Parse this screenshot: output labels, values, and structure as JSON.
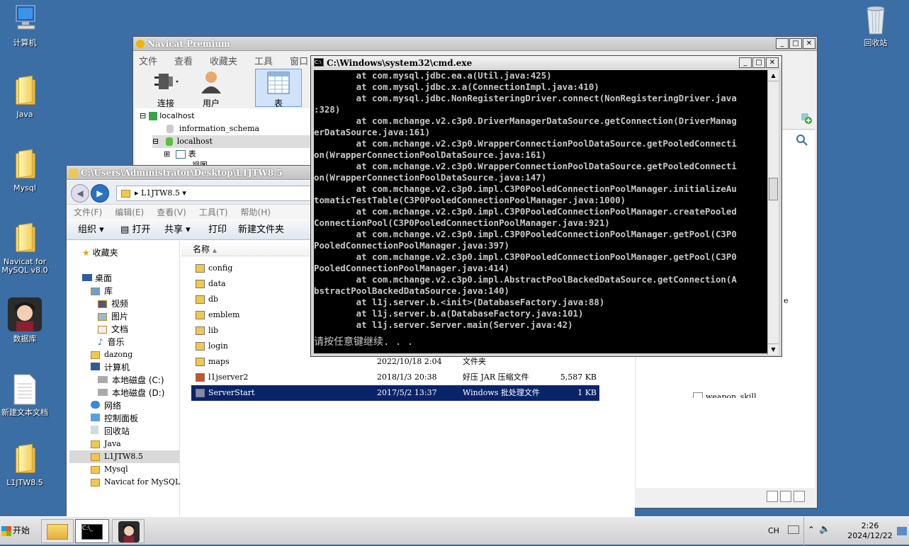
{
  "desktop": {
    "icons": [
      {
        "label": "计算机",
        "icon": "computer-icon"
      },
      {
        "label": "Java",
        "icon": "folder-icon"
      },
      {
        "label": "Mysql",
        "icon": "folder-icon"
      },
      {
        "label": "Navicat for MySQL v8.0",
        "icon": "folder-icon"
      },
      {
        "label": "数据库",
        "icon": "avatar-icon"
      },
      {
        "label": "新建文本文档",
        "icon": "text-file-icon"
      },
      {
        "label": "L1JTW8.5",
        "icon": "folder-icon"
      },
      {
        "label": "回收站",
        "icon": "recycle-bin-icon"
      }
    ]
  },
  "navicat": {
    "title": "Navicat Premium",
    "menu": [
      "文件",
      "查看",
      "收藏夹",
      "工具",
      "窗口"
    ],
    "toolbar": {
      "connect": "连接",
      "user": "用户",
      "table": "表"
    },
    "tree": {
      "root": "localhost",
      "db1": "information_schema",
      "db2": "localhost",
      "table_node": "表",
      "clipped": "视图"
    },
    "right_item": "weapon_skill",
    "right_clipped": "e"
  },
  "explorer": {
    "title": "C:\\Users\\Administrator\\Desktop\\L1JTW8.5",
    "address": "L1JTW8.5",
    "menu": [
      "文件(F)",
      "编辑(E)",
      "查看(V)",
      "工具(T)",
      "帮助(H)"
    ],
    "toolbar": [
      "组织",
      "打开",
      "共享",
      "打印",
      "新建文件夹"
    ],
    "column_name": "名称",
    "sidebar": {
      "favorites": "收藏夹",
      "desktop": "桌面",
      "library": "库",
      "video": "视频",
      "pictures": "图片",
      "docs": "文档",
      "music": "音乐",
      "dazong": "dazong",
      "computer": "计算机",
      "disk_c": "本地磁盘 (C:)",
      "disk_d": "本地磁盘 (D:)",
      "network": "网络",
      "control_panel": "控制面板",
      "recycle": "回收站",
      "java": "Java",
      "l1jtw": "L1JTW8.5",
      "mysql": "Mysql",
      "navicat": "Navicat for MySQL"
    },
    "files": [
      {
        "name": "config",
        "date": "",
        "type": "",
        "size": ""
      },
      {
        "name": "data",
        "date": "",
        "type": "",
        "size": ""
      },
      {
        "name": "db",
        "date": "",
        "type": "",
        "size": ""
      },
      {
        "name": "emblem",
        "date": "",
        "type": "",
        "size": ""
      },
      {
        "name": "lib",
        "date": "",
        "type": "",
        "size": ""
      },
      {
        "name": "login",
        "date": "",
        "type": "",
        "size": ""
      },
      {
        "name": "maps",
        "date": "2022/10/18 2:04",
        "type": "文件夹",
        "size": ""
      },
      {
        "name": "l1jserver2",
        "date": "2018/1/3 20:38",
        "type": "好压 JAR 压缩文件",
        "size": "5,587 KB"
      },
      {
        "name": "ServerStart",
        "date": "2017/5/2 13:37",
        "type": "Windows 批处理文件",
        "size": "1 KB"
      }
    ]
  },
  "cmd": {
    "title": "C:\\Windows\\system32\\cmd.exe",
    "lines": [
      "        at com.mysql.jdbc.ea.a(Util.java:425)",
      "        at com.mysql.jdbc.x.a(ConnectionImpl.java:410)",
      "        at com.mysql.jdbc.NonRegisteringDriver.connect(NonRegisteringDriver.java",
      ":328)",
      "        at com.mchange.v2.c3p0.DriverManagerDataSource.getConnection(DriverManag",
      "erDataSource.java:161)",
      "        at com.mchange.v2.c3p0.WrapperConnectionPoolDataSource.getPooledConnecti",
      "on(WrapperConnectionPoolDataSource.java:161)",
      "        at com.mchange.v2.c3p0.WrapperConnectionPoolDataSource.getPooledConnecti",
      "on(WrapperConnectionPoolDataSource.java:147)",
      "        at com.mchange.v2.c3p0.impl.C3P0PooledConnectionPoolManager.initializeAu",
      "tomaticTestTable(C3P0PooledConnectionPoolManager.java:1000)",
      "        at com.mchange.v2.c3p0.impl.C3P0PooledConnectionPoolManager.createPooled",
      "ConnectionPool(C3P0PooledConnectionPoolManager.java:921)",
      "        at com.mchange.v2.c3p0.impl.C3P0PooledConnectionPoolManager.getPool(C3P0",
      "PooledConnectionPoolManager.java:397)",
      "        at com.mchange.v2.c3p0.impl.C3P0PooledConnectionPoolManager.getPool(C3P0",
      "PooledConnectionPoolManager.java:414)",
      "        at com.mchange.v2.c3p0.impl.AbstractPoolBackedDataSource.getConnection(A",
      "bstractPoolBackedDataSource.java:140)",
      "        at l1j.server.b.<init>(DatabaseFactory.java:88)",
      "        at l1j.server.b.a(DatabaseFactory.java:101)",
      "        at l1j.server.Server.main(Server.java:42)"
    ],
    "prompt": "请按任意键继续. . ."
  },
  "taskbar": {
    "start": "开始",
    "lang": "CH",
    "time": "2:26",
    "date": "2024/12/22"
  }
}
